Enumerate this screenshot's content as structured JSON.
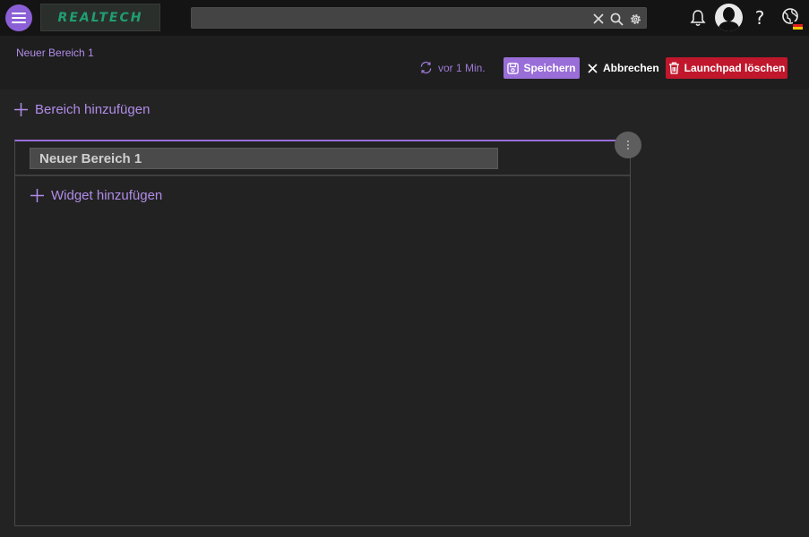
{
  "topbar": {
    "menu_icon": "hamburger-menu-icon",
    "logo_text": "REALTECH",
    "search": {
      "value": "",
      "placeholder": ""
    },
    "icons": [
      "clear-icon",
      "search-icon",
      "settings-icon",
      "bell-icon",
      "avatar",
      "help-icon",
      "globe-user-icon",
      "german-flag-icon"
    ],
    "help_label": "?"
  },
  "header": {
    "title": "Neuer Bereich 1",
    "sync_text": "vor 1 Min.",
    "save_label": "Speichern",
    "cancel_label": "Abbrechen",
    "delete_label": "Launchpad löschen"
  },
  "main": {
    "add_area_label": "Bereich hinzufügen",
    "areas": [
      {
        "name": "Neuer Bereich 1",
        "add_widget_label": "Widget hinzufügen"
      }
    ]
  },
  "colors": {
    "accent": "#9a6ed8",
    "accent_text": "#b08ce8",
    "danger": "#c0172c",
    "topbar_bg": "#141414",
    "page_bg": "#232323",
    "logo_green": "#1f9e74"
  }
}
